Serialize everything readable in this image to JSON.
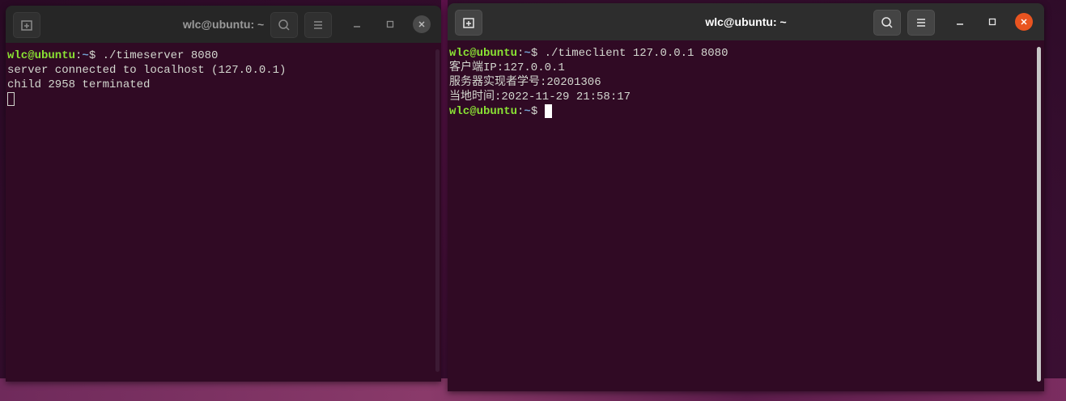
{
  "left_window": {
    "title": "wlc@ubuntu: ~",
    "lines": [
      {
        "user": "wlc@ubuntu",
        "sep": ":",
        "path": "~",
        "cmd": "$ ./timeserver 8080"
      },
      {
        "text": "server connected to localhost (127.0.0.1)"
      },
      {
        "text": "child 2958 terminated"
      }
    ]
  },
  "right_window": {
    "title": "wlc@ubuntu: ~",
    "lines": [
      {
        "user": "wlc@ubuntu",
        "sep": ":",
        "path": "~",
        "cmd": "$ ./timeclient 127.0.0.1 8080"
      },
      {
        "text": "客户端IP:127.0.0.1"
      },
      {
        "text": "服务器实现者学号:20201306"
      },
      {
        "text": "当地时间:2022-11-29 21:58:17"
      },
      {
        "user": "wlc@ubuntu",
        "sep": ":",
        "path": "~",
        "cmd": "$ "
      }
    ]
  },
  "icons": {
    "new_tab": "new-tab-icon",
    "search": "search-icon",
    "menu": "hamburger-menu-icon",
    "minimize": "minimize-icon",
    "maximize": "maximize-icon",
    "close": "close-icon"
  },
  "colors": {
    "terminal_bg": "#300a24",
    "prompt_user": "#8ae234",
    "prompt_path": "#729fcf",
    "close_active": "#e95420"
  }
}
